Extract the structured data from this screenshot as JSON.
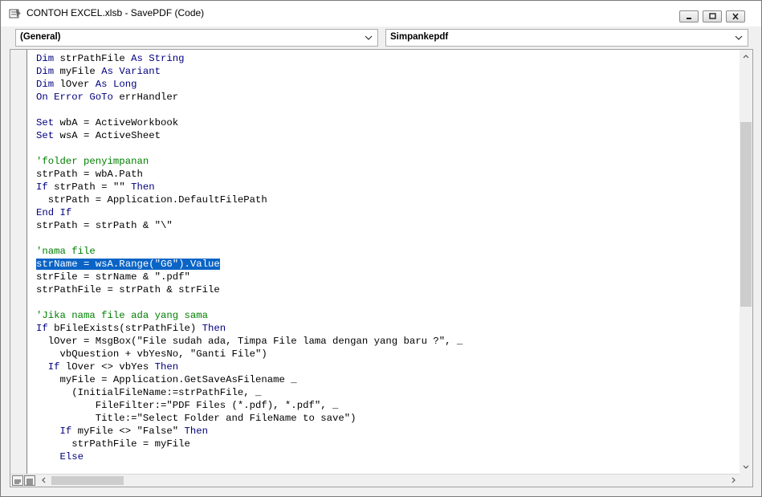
{
  "window": {
    "title": "CONTOH EXCEL.xlsb - SavePDF (Code)"
  },
  "object_combo": {
    "value": "(General)"
  },
  "procedure_combo": {
    "value": "Simpankepdf"
  },
  "code_lines": [
    [
      {
        "t": "Dim",
        "c": "kw"
      },
      {
        "t": " strPathFile "
      },
      {
        "t": "As",
        "c": "kw"
      },
      {
        "t": " "
      },
      {
        "t": "String",
        "c": "kw"
      }
    ],
    [
      {
        "t": "Dim",
        "c": "kw"
      },
      {
        "t": " myFile "
      },
      {
        "t": "As",
        "c": "kw"
      },
      {
        "t": " "
      },
      {
        "t": "Variant",
        "c": "kw"
      }
    ],
    [
      {
        "t": "Dim",
        "c": "kw"
      },
      {
        "t": " lOver "
      },
      {
        "t": "As",
        "c": "kw"
      },
      {
        "t": " "
      },
      {
        "t": "Long",
        "c": "kw"
      }
    ],
    [
      {
        "t": "On Error GoTo",
        "c": "kw"
      },
      {
        "t": " errHandler"
      }
    ],
    [],
    [
      {
        "t": "Set",
        "c": "kw"
      },
      {
        "t": " wbA = ActiveWorkbook"
      }
    ],
    [
      {
        "t": "Set",
        "c": "kw"
      },
      {
        "t": " wsA = ActiveSheet"
      }
    ],
    [],
    [
      {
        "t": "'folder penyimpanan",
        "c": "cm"
      }
    ],
    [
      {
        "t": "strPath = wbA.Path"
      }
    ],
    [
      {
        "t": "If",
        "c": "kw"
      },
      {
        "t": " strPath = \"\" "
      },
      {
        "t": "Then",
        "c": "kw"
      }
    ],
    [
      {
        "t": "  strPath = Application.DefaultFilePath"
      }
    ],
    [
      {
        "t": "End If",
        "c": "kw"
      }
    ],
    [
      {
        "t": "strPath = strPath & \"\\\""
      }
    ],
    [],
    [
      {
        "t": "'nama file",
        "c": "cm"
      }
    ],
    [
      {
        "t": "strName = wsA.Range(\"G6\").Value",
        "c": "hl"
      }
    ],
    [
      {
        "t": "strFile = strName & \".pdf\""
      }
    ],
    [
      {
        "t": "strPathFile = strPath & strFile"
      }
    ],
    [],
    [
      {
        "t": "'Jika nama file ada yang sama",
        "c": "cm"
      }
    ],
    [
      {
        "t": "If",
        "c": "kw"
      },
      {
        "t": " bFileExists(strPathFile) "
      },
      {
        "t": "Then",
        "c": "kw"
      }
    ],
    [
      {
        "t": "  lOver = MsgBox(\"File sudah ada, Timpa File lama dengan yang baru ?\", _"
      }
    ],
    [
      {
        "t": "    vbQuestion + vbYesNo, \"Ganti File\")"
      }
    ],
    [
      {
        "t": "  "
      },
      {
        "t": "If",
        "c": "kw"
      },
      {
        "t": " lOver <> vbYes "
      },
      {
        "t": "Then",
        "c": "kw"
      }
    ],
    [
      {
        "t": "    myFile = Application.GetSaveAsFilename _"
      }
    ],
    [
      {
        "t": "      (InitialFileName:=strPathFile, _"
      }
    ],
    [
      {
        "t": "          FileFilter:=\"PDF Files (*.pdf), *.pdf\", _"
      }
    ],
    [
      {
        "t": "          Title:=\"Select Folder and FileName to save\")"
      }
    ],
    [
      {
        "t": "    "
      },
      {
        "t": "If",
        "c": "kw"
      },
      {
        "t": " myFile <> \"False\" "
      },
      {
        "t": "Then",
        "c": "kw"
      }
    ],
    [
      {
        "t": "      strPathFile = myFile"
      }
    ],
    [
      {
        "t": "    "
      },
      {
        "t": "Else",
        "c": "kw"
      }
    ]
  ]
}
